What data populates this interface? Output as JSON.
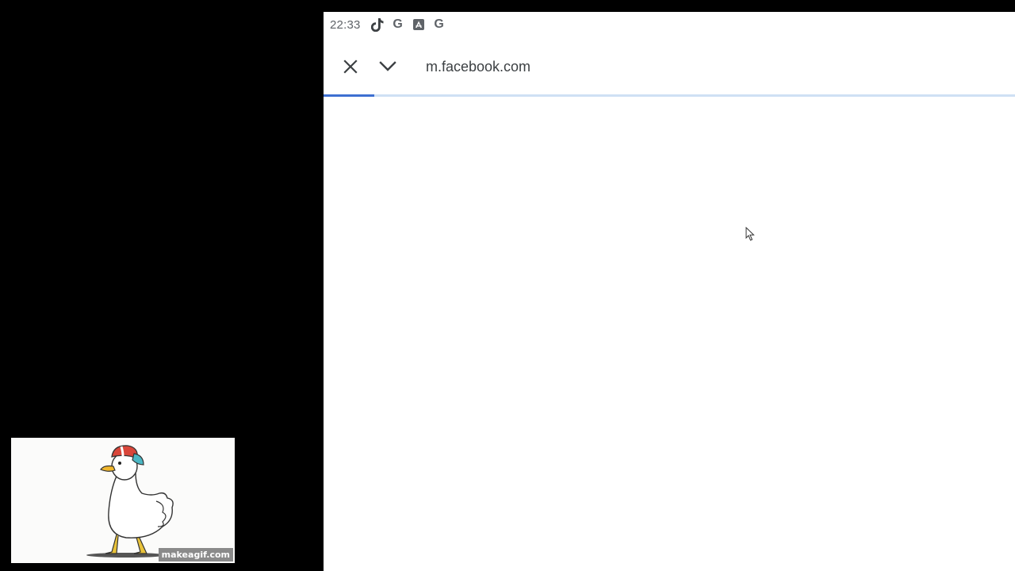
{
  "status_bar": {
    "time": "22:33",
    "icons": [
      "tiktok-icon",
      "google-icon",
      "app-store-icon",
      "google-icon"
    ],
    "google_letter": "G"
  },
  "toolbar": {
    "close_icon": "close-icon",
    "dropdown_icon": "chevron-down-icon",
    "url": "m.facebook.com"
  },
  "page_load": {
    "progress_fraction": 0.073
  },
  "gif_overlay": {
    "watermark": "makeagif.com"
  },
  "colors": {
    "progress": "#3d6fd1",
    "progress_track": "#cfe0f4",
    "status_text": "#5f6368"
  }
}
